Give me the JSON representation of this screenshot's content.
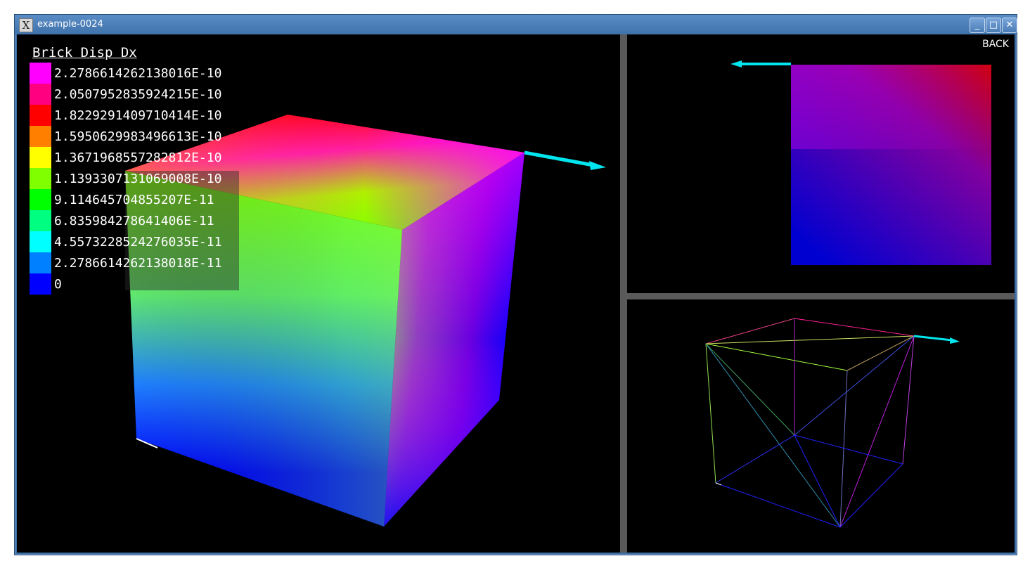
{
  "window": {
    "title": "example-0024",
    "icon": "x-window-icon",
    "controls": {
      "minimize": "_",
      "maximize": "□",
      "close": "✕"
    }
  },
  "colors": {
    "titlebar": "#3f72aa",
    "splitter": "#5a5a5a",
    "arrow": "#00e5ee",
    "background": "#000000"
  },
  "legend": {
    "title": "Brick Disp Dx",
    "items": [
      {
        "value": "2.2786614262138016E-10",
        "color": "#ff00ff"
      },
      {
        "value": "2.0507952835924215E-10",
        "color": "#ff0080"
      },
      {
        "value": "1.8229291409710414E-10",
        "color": "#ff0000"
      },
      {
        "value": "1.5950629983496613E-10",
        "color": "#ff8000"
      },
      {
        "value": "1.3671968557282812E-10",
        "color": "#ffff00"
      },
      {
        "value": "1.1393307131069008E-10",
        "color": "#80ff00"
      },
      {
        "value": "9.114645704855207E-11",
        "color": "#00ff00"
      },
      {
        "value": "6.835984278641406E-11",
        "color": "#00ff80"
      },
      {
        "value": "4.5573228524276035E-11",
        "color": "#00ffff"
      },
      {
        "value": "2.2786614262138018E-11",
        "color": "#0080ff"
      },
      {
        "value": "0",
        "color": "#0000ff"
      }
    ]
  },
  "top_view": {
    "back_label": "BACK"
  }
}
